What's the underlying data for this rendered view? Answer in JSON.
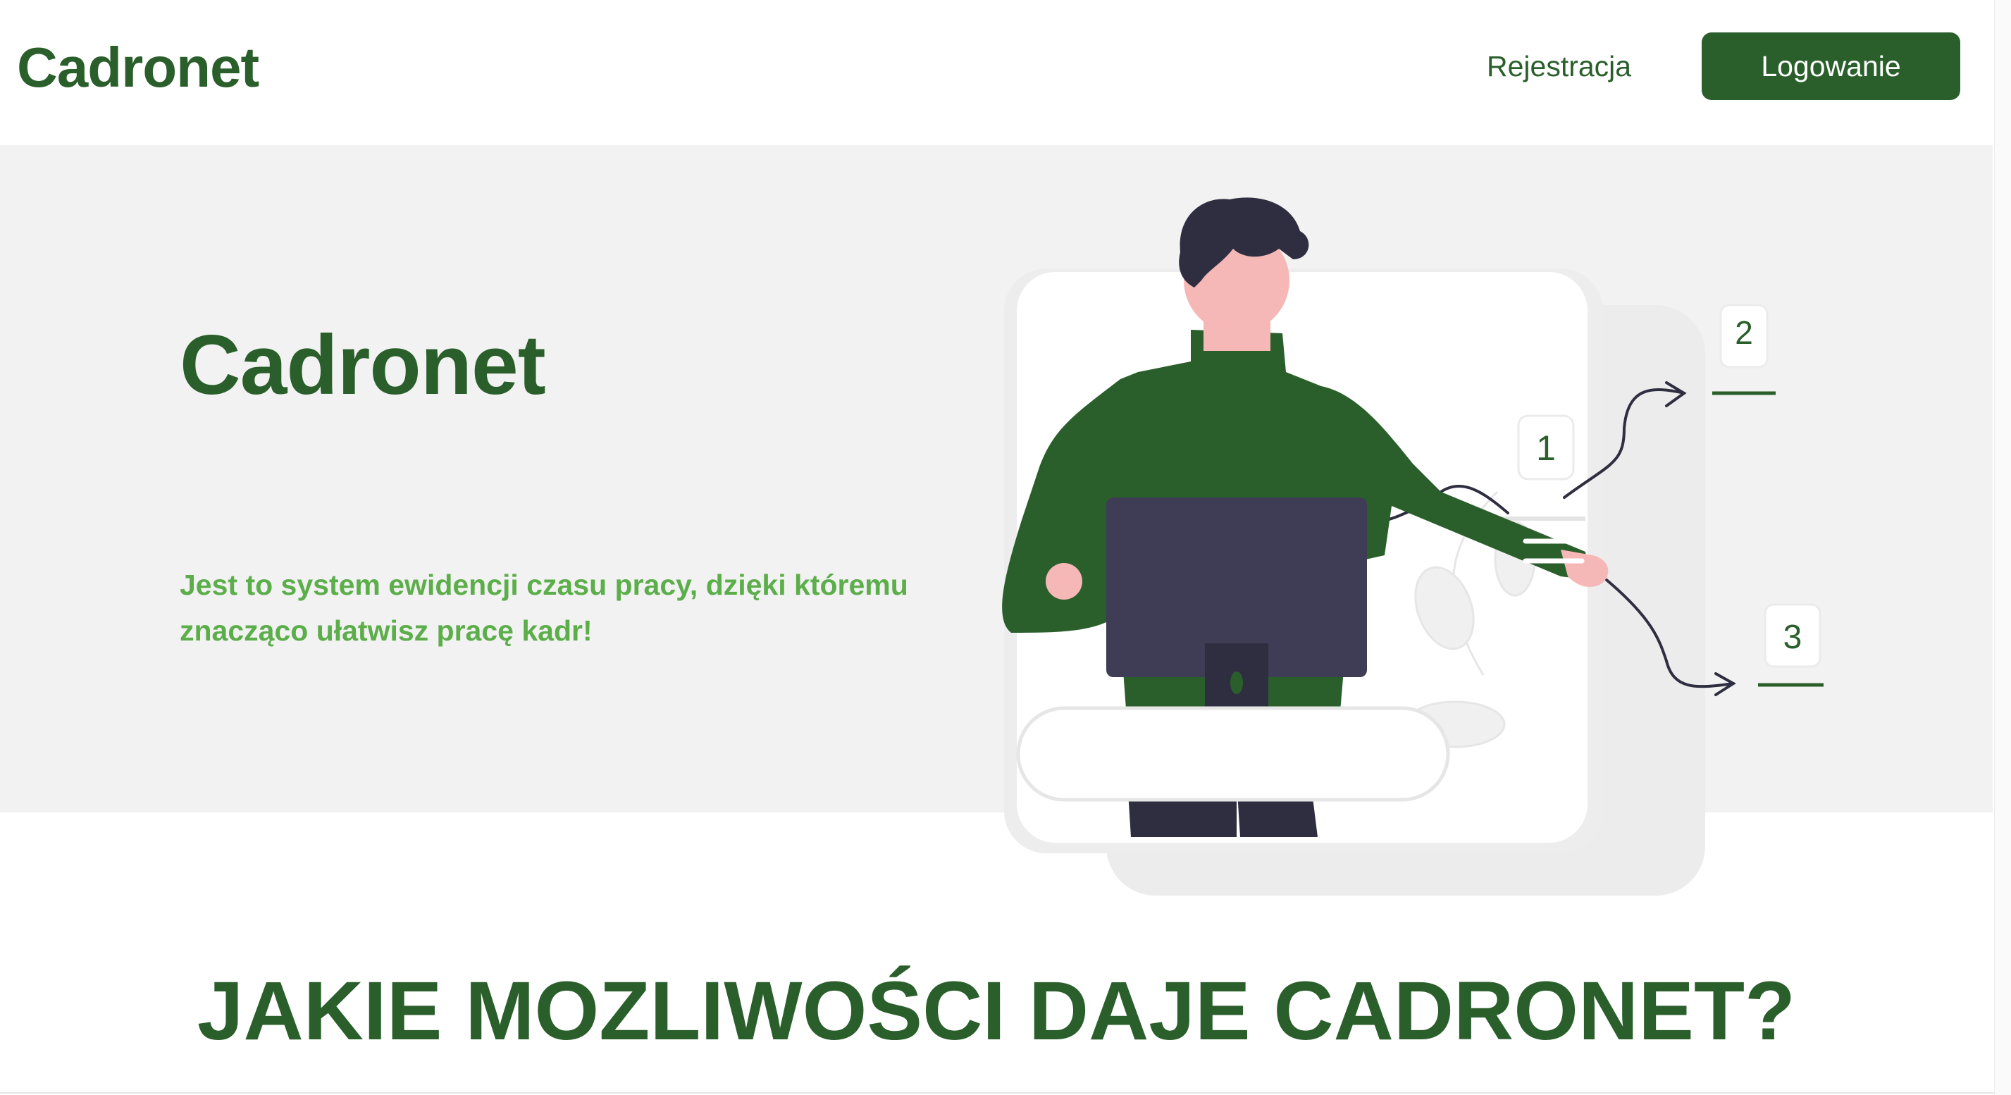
{
  "header": {
    "brand": "Cadronet",
    "nav_register": "Rejestracja",
    "nav_login": "Logowanie"
  },
  "hero": {
    "title": "Cadronet",
    "description": "Jest to system ewidencji czasu pracy, dzięki któremu znacząco ułatwisz pracę kadr!",
    "illustration": {
      "step_1": "1",
      "step_2": "2",
      "step_3": "3"
    }
  },
  "features": {
    "heading": "JAKIE MOZLIWOŚCI DAJE CADRONET?"
  },
  "colors": {
    "brand_green": "#2a5f2b",
    "accent_green": "#5cae4a",
    "hero_background": "#f2f2f2",
    "monitor": "#3f3d56",
    "skin": "#f5b8b7"
  }
}
